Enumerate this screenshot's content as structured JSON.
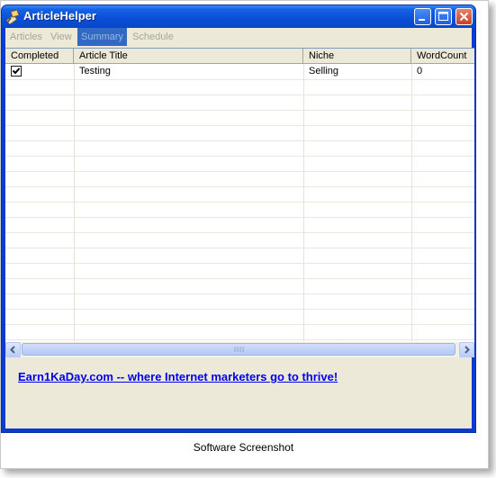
{
  "window": {
    "title": "ArticleHelper"
  },
  "menu": {
    "items": [
      "Articles",
      "View",
      "Summary",
      "Schedule"
    ],
    "active": "Summary"
  },
  "table": {
    "columns": [
      "Completed",
      "Article Title",
      "Niche",
      "WordCount"
    ],
    "rows": [
      {
        "completed": true,
        "title": "Testing",
        "niche": "Selling",
        "word_count": "0"
      }
    ]
  },
  "footer": {
    "link_text": "Earn1KaDay.com -- where Internet marketers go to thrive!"
  },
  "caption": "Software Screenshot",
  "colors": {
    "titlebar": "#0a4fd8",
    "client_bg": "#ece9d8",
    "link": "#0000ee"
  },
  "icons": [
    "app-icon",
    "minimize-icon",
    "maximize-icon",
    "close-icon",
    "checkmark-icon",
    "scroll-left-icon",
    "scroll-right-icon",
    "scroll-grip-icon"
  ]
}
